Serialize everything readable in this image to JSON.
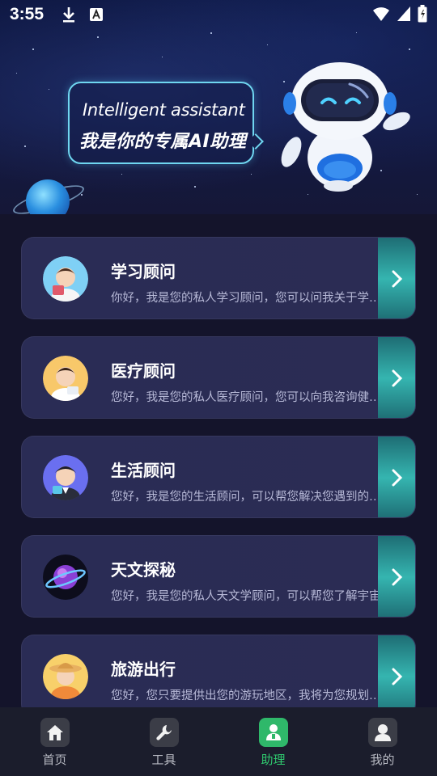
{
  "status_bar": {
    "time": "3:55"
  },
  "hero": {
    "english_text": "Intelligent assistant",
    "chinese_text": "我是你的专属AI助理"
  },
  "cards": [
    {
      "title": "学习顾问",
      "description": "你好，我是您的私人学习顾问，您可以问我关于学习的问题",
      "avatar_icon": "student-avatar-icon"
    },
    {
      "title": "医疗顾问",
      "description": "您好，我是您的私人医疗顾问，您可以向我咨询健康问题",
      "avatar_icon": "doctor-avatar-icon"
    },
    {
      "title": "生活顾问",
      "description": "您好，我是您的生活顾问，可以帮您解决您遇到的问题",
      "avatar_icon": "life-avatar-icon"
    },
    {
      "title": "天文探秘",
      "description": "您好，我是您的私人天文学顾问，可以帮您了解宇宙",
      "avatar_icon": "planet-avatar-icon"
    },
    {
      "title": "旅游出行",
      "description": "您好，您只要提供出您的游玩地区，我将为您规划行程",
      "avatar_icon": "traveler-avatar-icon"
    }
  ],
  "bottom_nav": {
    "items": [
      {
        "label": "首页",
        "icon": "home-icon"
      },
      {
        "label": "工具",
        "icon": "wrench-icon"
      },
      {
        "label": "助理",
        "icon": "assistant-icon"
      },
      {
        "label": "我的",
        "icon": "profile-icon"
      }
    ],
    "active_index": 2
  },
  "colors": {
    "accent": "#2fb86a",
    "card_bg": "#2a2c55",
    "arrow_bg": "#35b5b0",
    "page_bg": "#14142b"
  }
}
